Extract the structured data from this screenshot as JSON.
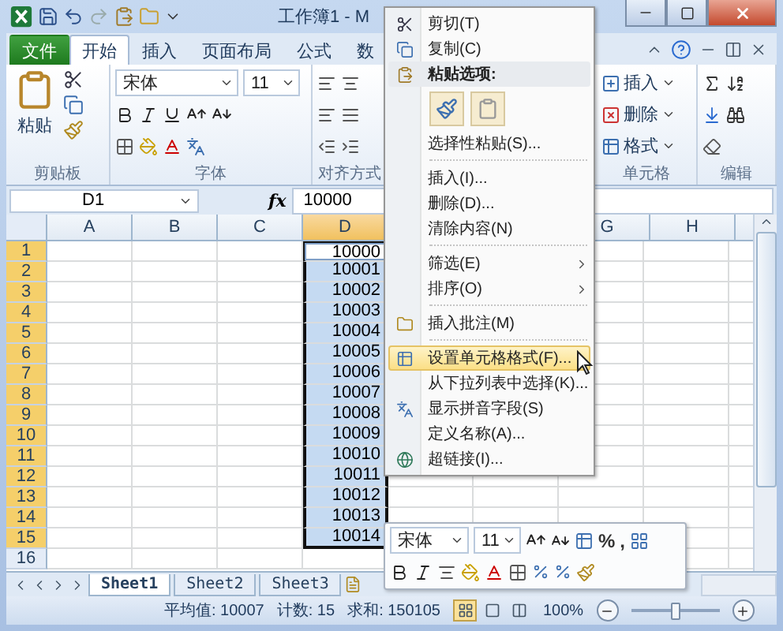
{
  "window": {
    "title": "工作簿1 - M"
  },
  "ribbon_tabs": [
    {
      "label": "文件",
      "kind": "file",
      "selected": false
    },
    {
      "label": "开始",
      "kind": "tab",
      "selected": true
    },
    {
      "label": "插入",
      "kind": "tab",
      "selected": false
    },
    {
      "label": "页面布局",
      "kind": "tab",
      "selected": false
    },
    {
      "label": "公式",
      "kind": "tab",
      "selected": false
    },
    {
      "label": "数",
      "kind": "tab",
      "selected": false
    }
  ],
  "ribbon": {
    "clipboard": {
      "paste_label": "粘贴",
      "group_label": "剪贴板"
    },
    "font": {
      "font_name": "宋体",
      "font_size": "11",
      "group_label": "字体"
    },
    "alignment": {
      "group_label": "对齐方式"
    },
    "cells": {
      "buttons": [
        "插入",
        "删除",
        "格式"
      ],
      "group_label": "单元格"
    },
    "editing": {
      "group_label": "编辑"
    }
  },
  "formula_bar": {
    "name_box": "D1",
    "function_label": "fx",
    "value": "10000"
  },
  "sheet": {
    "columns": [
      {
        "label": "A",
        "selected": false
      },
      {
        "label": "B",
        "selected": false
      },
      {
        "label": "C",
        "selected": false
      },
      {
        "label": "D",
        "selected": true
      }
    ],
    "columns_after_menu": [
      {
        "label": "G",
        "selected": false
      },
      {
        "label": "H",
        "selected": false
      }
    ],
    "rows": [
      {
        "label": "1",
        "selected": true,
        "active": true,
        "value": "10000"
      },
      {
        "label": "2",
        "selected": true,
        "active": false,
        "value": "10001"
      },
      {
        "label": "3",
        "selected": true,
        "active": false,
        "value": "10002"
      },
      {
        "label": "4",
        "selected": true,
        "active": false,
        "value": "10003"
      },
      {
        "label": "5",
        "selected": true,
        "active": false,
        "value": "10004"
      },
      {
        "label": "6",
        "selected": true,
        "active": false,
        "value": "10005"
      },
      {
        "label": "7",
        "selected": true,
        "active": false,
        "value": "10006"
      },
      {
        "label": "8",
        "selected": true,
        "active": false,
        "value": "10007"
      },
      {
        "label": "9",
        "selected": true,
        "active": false,
        "value": "10008"
      },
      {
        "label": "10",
        "selected": true,
        "active": false,
        "value": "10009"
      },
      {
        "label": "11",
        "selected": true,
        "active": false,
        "value": "10010"
      },
      {
        "label": "12",
        "selected": true,
        "active": false,
        "value": "10011"
      },
      {
        "label": "13",
        "selected": true,
        "active": false,
        "value": "10012"
      },
      {
        "label": "14",
        "selected": true,
        "active": false,
        "value": "10013"
      },
      {
        "label": "15",
        "selected": true,
        "active": false,
        "value": "10014"
      },
      {
        "label": "16",
        "selected": false,
        "active": false
      }
    ]
  },
  "context_menu": [
    {
      "kind": "cut",
      "label": "剪切(T)",
      "selected": false
    },
    {
      "kind": "copy",
      "label": "复制(C)",
      "selected": false
    },
    {
      "kind": "header",
      "label": "粘贴选项:"
    },
    {
      "kind": "paste-buttons"
    },
    {
      "kind": "command",
      "label": "选择性粘贴(S)...",
      "selected": false
    },
    {
      "kind": "separator"
    },
    {
      "kind": "command",
      "label": "插入(I)...",
      "selected": false
    },
    {
      "kind": "command",
      "label": "删除(D)...",
      "selected": false
    },
    {
      "kind": "command",
      "label": "清除内容(N)",
      "selected": false
    },
    {
      "kind": "separator"
    },
    {
      "kind": "submenu",
      "label": "筛选(E)",
      "selected": false
    },
    {
      "kind": "submenu",
      "label": "排序(O)",
      "selected": false
    },
    {
      "kind": "separator"
    },
    {
      "kind": "comment",
      "label": "插入批注(M)",
      "selected": false
    },
    {
      "kind": "separator"
    },
    {
      "kind": "format",
      "label": "设置单元格格式(F)...",
      "selected": true
    },
    {
      "kind": "command",
      "label": "从下拉列表中选择(K)...",
      "selected": false
    },
    {
      "kind": "phonetic",
      "label": "显示拼音字段(S)",
      "selected": false
    },
    {
      "kind": "command",
      "label": "定义名称(A)...",
      "selected": false
    },
    {
      "kind": "hyperlink",
      "label": "超链接(I)...",
      "selected": false
    }
  ],
  "mini_toolbar": {
    "font_name": "宋体",
    "font_size": "11",
    "percent": "%",
    "comma": ","
  },
  "sheet_tabs": [
    {
      "label": "Sheet1",
      "selected": true
    },
    {
      "label": "Sheet2",
      "selected": false
    },
    {
      "label": "Sheet3",
      "selected": false
    }
  ],
  "status_bar": {
    "average": "平均值: 10007",
    "count": "计数: 15",
    "sum": "求和: 150105",
    "views": [
      {
        "selected": true
      },
      {
        "selected": false
      },
      {
        "selected": false
      }
    ],
    "zoom": "100%",
    "zoom_slider": {
      "level": 0.5
    }
  }
}
